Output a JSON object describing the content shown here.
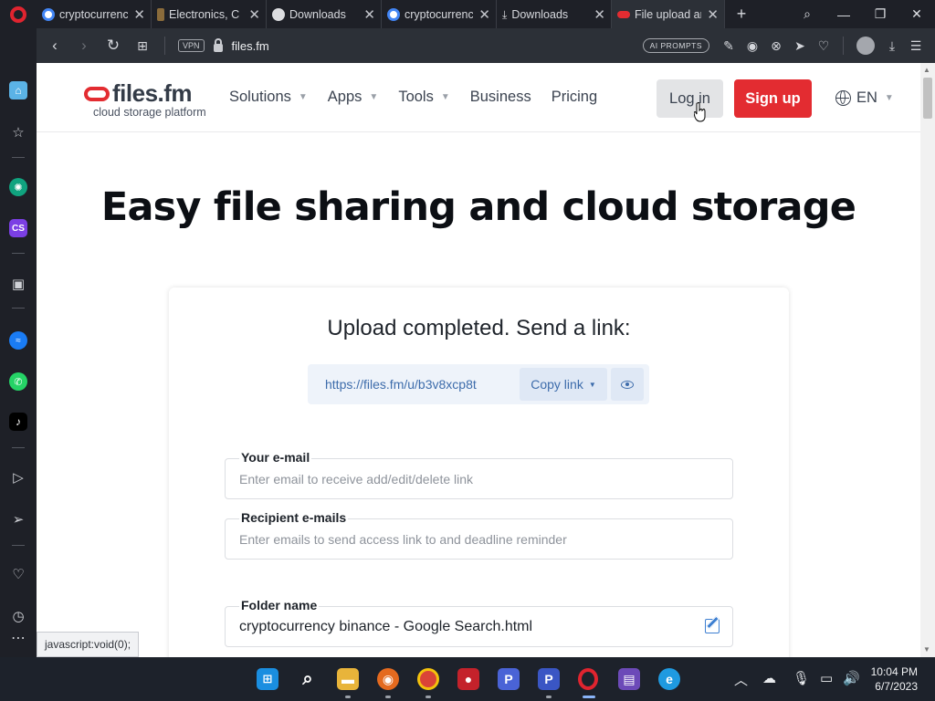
{
  "browser": {
    "tabs": [
      {
        "title": "cryptocurrenc",
        "favicon_color": "#4285f4"
      },
      {
        "title": "Electronics, C",
        "favicon_color": "#8a6b3b"
      },
      {
        "title": "Downloads",
        "favicon_color": "#dcdde0"
      },
      {
        "title": "cryptocurrenc",
        "favicon_color": "#4285f4"
      },
      {
        "title": "Downloads",
        "favicon_color": "#dcdde0"
      },
      {
        "title": "File upload ar",
        "favicon_color": "#e32c31"
      }
    ],
    "active_tab_index": 5,
    "address": "files.fm",
    "vpn_label": "VPN",
    "ai_prompts_label": "AI PROMPTS"
  },
  "site": {
    "logo_brand": "files.fm",
    "logo_tagline": "cloud storage platform",
    "nav": [
      {
        "label": "Solutions",
        "dropdown": true
      },
      {
        "label": "Apps",
        "dropdown": true
      },
      {
        "label": "Tools",
        "dropdown": true
      },
      {
        "label": "Business",
        "dropdown": false
      },
      {
        "label": "Pricing",
        "dropdown": false
      }
    ],
    "login_label": "Log in",
    "signup_label": "Sign up",
    "language": "EN",
    "hero_title": "Easy file sharing and cloud storage"
  },
  "upload": {
    "title": "Upload completed. Send a link:",
    "link_url": "https://files.fm/u/b3v8xcp8t",
    "copy_label": "Copy link",
    "email_label": "Your e-mail",
    "email_placeholder": "Enter email to receive add/edit/delete link",
    "recipients_label": "Recipient e-mails",
    "recipients_placeholder": "Enter emails to send access link to and deadline reminder",
    "folder_label": "Folder name",
    "folder_value": "cryptocurrency binance - Google Search.html"
  },
  "status_tooltip": "javascript:void(0);",
  "taskbar": {
    "time": "10:04 PM",
    "date": "6/7/2023"
  },
  "colors": {
    "brand_red": "#e32c31",
    "link_blue": "#3d6cab"
  }
}
